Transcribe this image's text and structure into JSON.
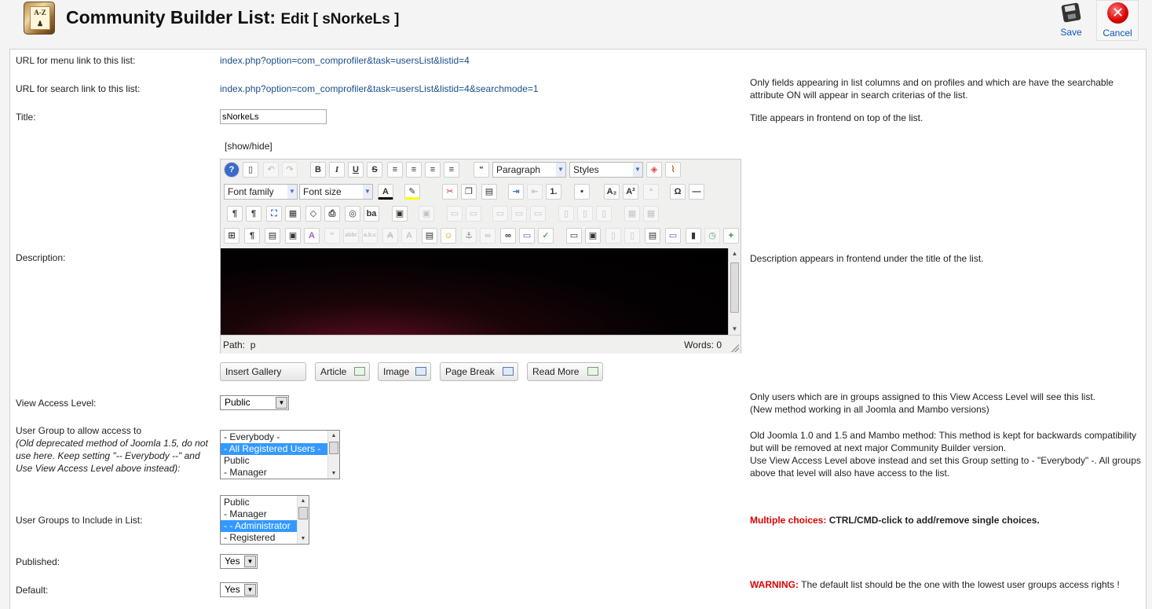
{
  "header": {
    "title": "Community Builder List:",
    "subtitle": "Edit [ sNorkeLs ]",
    "save_label": "Save",
    "cancel_label": "Cancel"
  },
  "rows": {
    "menu_link": {
      "label": "URL for menu link to this list:",
      "value": "index.php?option=com_comprofiler&task=usersList&listid=4"
    },
    "search_link": {
      "label": "URL for search link to this list:",
      "value": "index.php?option=com_comprofiler&task=usersList&listid=4&searchmode=1",
      "desc": "Only fields appearing in list columns and on profiles and which are have the searchable attribute ON will appear in search criterias of the list."
    },
    "title": {
      "label": "Title:",
      "value": "sNorkeLs",
      "desc": "Title appears in frontend on top of the list."
    },
    "description": {
      "label": "Description:",
      "show_hide": "[show/hide]",
      "desc": "Description appears in frontend under the title of the list."
    },
    "view_access": {
      "label": "View Access Level:",
      "value": "Public",
      "desc_line1": "Only users which are in groups assigned to this View Access Level will see this list.",
      "desc_line2": "(New method working in all Joomla and Mambo versions)"
    },
    "user_group": {
      "label": "User Group to allow access to",
      "note": "(Old deprecated method of Joomla 1.5, do not use here. Keep setting \"-- Everybody --\" and Use View Access Level above instead):",
      "options": [
        "- Everybody -",
        "- All Registered Users -",
        "Public",
        "- Manager"
      ],
      "selected_index": 1,
      "desc_line1": "Old Joomla 1.0 and 1.5 and Mambo method: This method is kept for backwards compatibility but will be removed at next major Community Builder version.",
      "desc_line2": "Use View Access Level above instead and set this Group setting to - \"Everybody\" -. All groups above that level will also have access to the list."
    },
    "include_groups": {
      "label": "User Groups to Include in List:",
      "options": [
        "Public",
        "- Manager",
        "- - Administrator",
        "- Registered"
      ],
      "selected_index": 2,
      "desc_strong": "Multiple choices:",
      "desc_rest": "CTRL/CMD-click to add/remove single choices."
    },
    "published": {
      "label": "Published:",
      "value": "Yes"
    },
    "default": {
      "label": "Default:",
      "value": "Yes",
      "desc_strong": "WARNING:",
      "desc_rest": "The default list should be the one with the lowest user groups access rights !"
    }
  },
  "editor": {
    "format_select": "Paragraph",
    "styles_select": "Styles",
    "font_family": "Font family",
    "font_size": "Font size",
    "path_label": "Path:",
    "path_value": "p",
    "words_label": "Words:",
    "words_value": "0",
    "buttons": {
      "insert_gallery": "Insert Gallery",
      "article": "Article",
      "image": "Image",
      "page_break": "Page Break",
      "read_more": "Read More"
    }
  }
}
